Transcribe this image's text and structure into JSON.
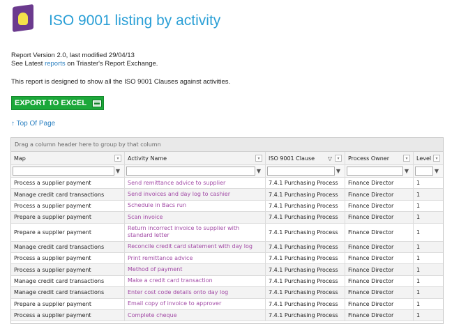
{
  "header": {
    "title": "ISO 9001 listing by activity"
  },
  "info": {
    "version_line": "Report Version 2.0, last modified 29/04/13",
    "see_prefix": "See Latest ",
    "see_link": "reports",
    "see_suffix": " on Triaster's Report Exchange.",
    "description": "This report is designed to show all the ISO 9001 Clauses against activities."
  },
  "export_label": "EXPORT TO EXCEL",
  "top_of_page": "↑ Top Of Page",
  "grid": {
    "group_hint": "Drag a column header here to group by that column",
    "columns": [
      "Map",
      "Activity Name",
      "ISO 9001 Clause",
      "Process Owner",
      "Level"
    ],
    "rows": [
      [
        "Process a supplier payment",
        "Send remittance advice to supplier",
        "7.4.1 Purchasing Process",
        "Finance Director",
        "1"
      ],
      [
        "Manage credit card transactions",
        "Send invoices and day log to cashier",
        "7.4.1 Purchasing Process",
        "Finance Director",
        "1"
      ],
      [
        "Process a supplier payment",
        "Schedule in Bacs run",
        "7.4.1 Purchasing Process",
        "Finance Director",
        "1"
      ],
      [
        "Prepare a supplier payment",
        "Scan invoice",
        "7.4.1 Purchasing Process",
        "Finance Director",
        "1"
      ],
      [
        "Prepare a supplier payment",
        "Return incorrect invoice to supplier with standard letter",
        "7.4.1 Purchasing Process",
        "Finance Director",
        "1"
      ],
      [
        "Manage credit card transactions",
        "Reconcile credit card statement with day log",
        "7.4.1 Purchasing Process",
        "Finance Director",
        "1"
      ],
      [
        "Process a supplier payment",
        "Print remittance advice",
        "7.4.1 Purchasing Process",
        "Finance Director",
        "1"
      ],
      [
        "Process a supplier payment",
        "Method of payment",
        "7.4.1 Purchasing Process",
        "Finance Director",
        "1"
      ],
      [
        "Manage credit card transactions",
        "Make a credit card transaction",
        "7.4.1 Purchasing Process",
        "Finance Director",
        "1"
      ],
      [
        "Manage credit card transactions",
        "Enter cost code details onto day log",
        "7.4.1 Purchasing Process",
        "Finance Director",
        "1"
      ],
      [
        "Prepare a supplier payment",
        "Email copy of invoice to approver",
        "7.4.1 Purchasing Process",
        "Finance Director",
        "1"
      ],
      [
        "Process a supplier payment",
        "Complete cheque",
        "7.4.1 Purchasing Process",
        "Finance Director",
        "1"
      ]
    ]
  }
}
